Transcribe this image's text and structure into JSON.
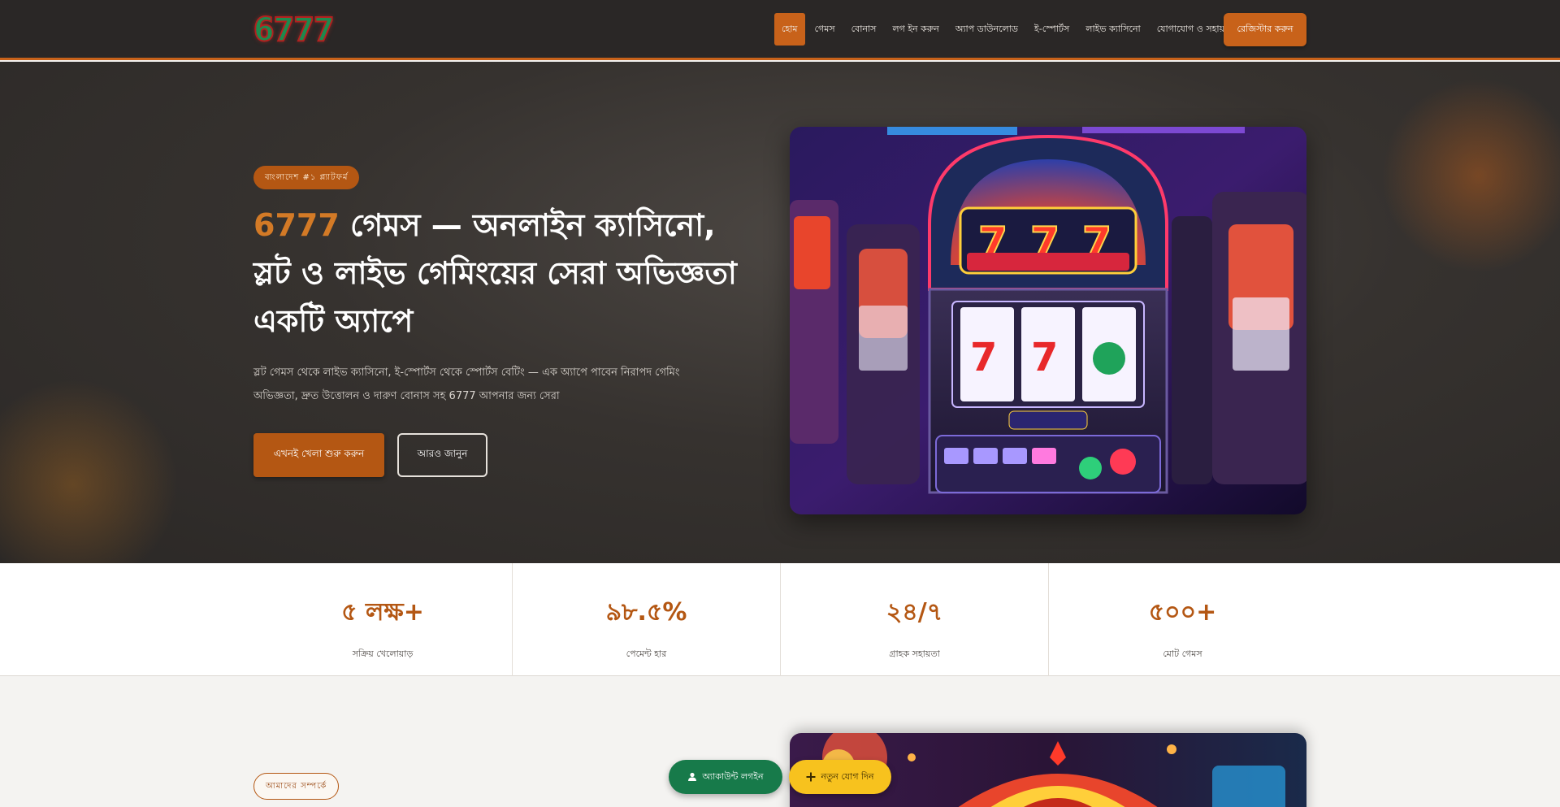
{
  "header": {
    "logo": "6777",
    "nav": [
      "হোম",
      "গেমস",
      "বোনাস",
      "লগ ইন করুন",
      "অ্যাপ ডাউনলোড",
      "ই-স্পোর্টস",
      "লাইভ ক্যাসিনো",
      "যোগাযোগ ও সহায়তা"
    ],
    "cta": "রেজিস্টার করুন"
  },
  "hero": {
    "badge": "বাংলাদেশ #১ প্ল্যাটফর্ম",
    "title_brand": "6777",
    "title_rest": " গেমস — অনলাইন ক্যাসিনো, স্লট ও লাইভ গেমিংয়ের সেরা অভিজ্ঞতা একটি অ্যাপে",
    "description": "স্লট গেমস থেকে লাইভ ক্যাসিনো, ই-স্পোর্টস থেকে স্পোর্টস বেটিং — এক অ্যাপে পাবেন নিরাপদ গেমিং অভিজ্ঞতা, দ্রুত উত্তোলন ও দারুণ বোনাস সহ 6777 আপনার জন্য সেরা",
    "primary_button": "এখনই খেলা শুরু করুন",
    "secondary_button": "আরও জানুন",
    "image_alt": "slot-machine-photo"
  },
  "stats": [
    {
      "value": "৫ লক্ষ+",
      "label": "সক্রিয় খেলোয়াড়"
    },
    {
      "value": "৯৮.৫%",
      "label": "পেমেন্ট হার"
    },
    {
      "value": "২৪/৭",
      "label": "গ্রাহক সহায়তা"
    },
    {
      "value": "৫০০+",
      "label": "মোট গেমস"
    }
  ],
  "section2": {
    "badge": "আমাদের সম্পর্কে"
  },
  "floating": {
    "login": "অ্যাকাউন্ট লগইন",
    "register": "নতুন যোগ দিন"
  }
}
